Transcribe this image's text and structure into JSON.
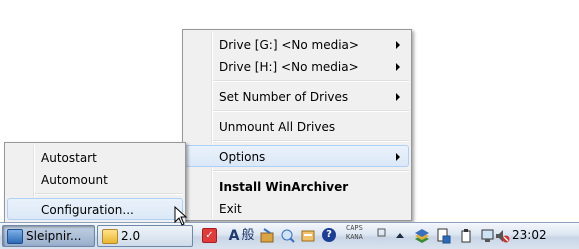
{
  "main_menu": {
    "items": [
      {
        "label": "Drive [G:] <No media>"
      },
      {
        "label": "Drive [H:] <No media>"
      },
      {
        "label": "Set Number of Drives"
      },
      {
        "label": "Unmount All Drives"
      },
      {
        "label": "Options"
      },
      {
        "label": "Install WinArchiver"
      },
      {
        "label": "Exit"
      }
    ]
  },
  "options_submenu": {
    "items": [
      {
        "label": "Autostart"
      },
      {
        "label": "Automount"
      },
      {
        "label": "Configuration..."
      }
    ]
  },
  "taskbar": {
    "buttons": [
      {
        "label": "Sleipnir...",
        "icon": "sleipnir-icon"
      },
      {
        "label": "2.0",
        "icon": "folder-icon"
      }
    ],
    "tray": {
      "ime_mode": "A",
      "ime_kanji": "般",
      "caps_label": "CAPS",
      "kana_label": "KANA",
      "clock": "23:02"
    }
  },
  "colors": {
    "menu_bg": "#f0f0f0",
    "menu_highlight": "#dbe8f7",
    "taskbar": "#dce6f2"
  }
}
